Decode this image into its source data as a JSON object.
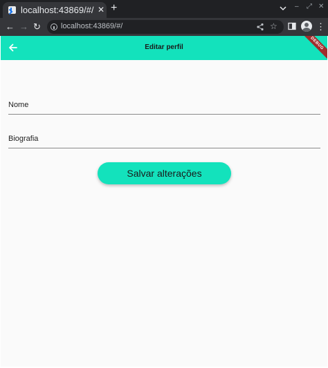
{
  "browser": {
    "tab_title": "localhost:43869/#/",
    "tab_close": "✕",
    "new_tab": "+",
    "url": "localhost:43869/#/",
    "back": "←",
    "forward": "→",
    "reload": "↻"
  },
  "app": {
    "title": "Editar perfil",
    "debug_banner": "DEBUG",
    "fields": {
      "name_label": "Nome",
      "bio_label": "Biografia"
    },
    "save_label": "Salvar alterações",
    "accent_color": "#13e2bc"
  },
  "icons": [
    "flutter-favicon-icon",
    "close-icon",
    "plus-icon",
    "chevron-down-icon",
    "arrow-back-icon",
    "arrow-forward-icon",
    "reload-icon",
    "info-icon",
    "share-icon",
    "star-icon",
    "sidebar-icon",
    "avatar-icon"
  ]
}
